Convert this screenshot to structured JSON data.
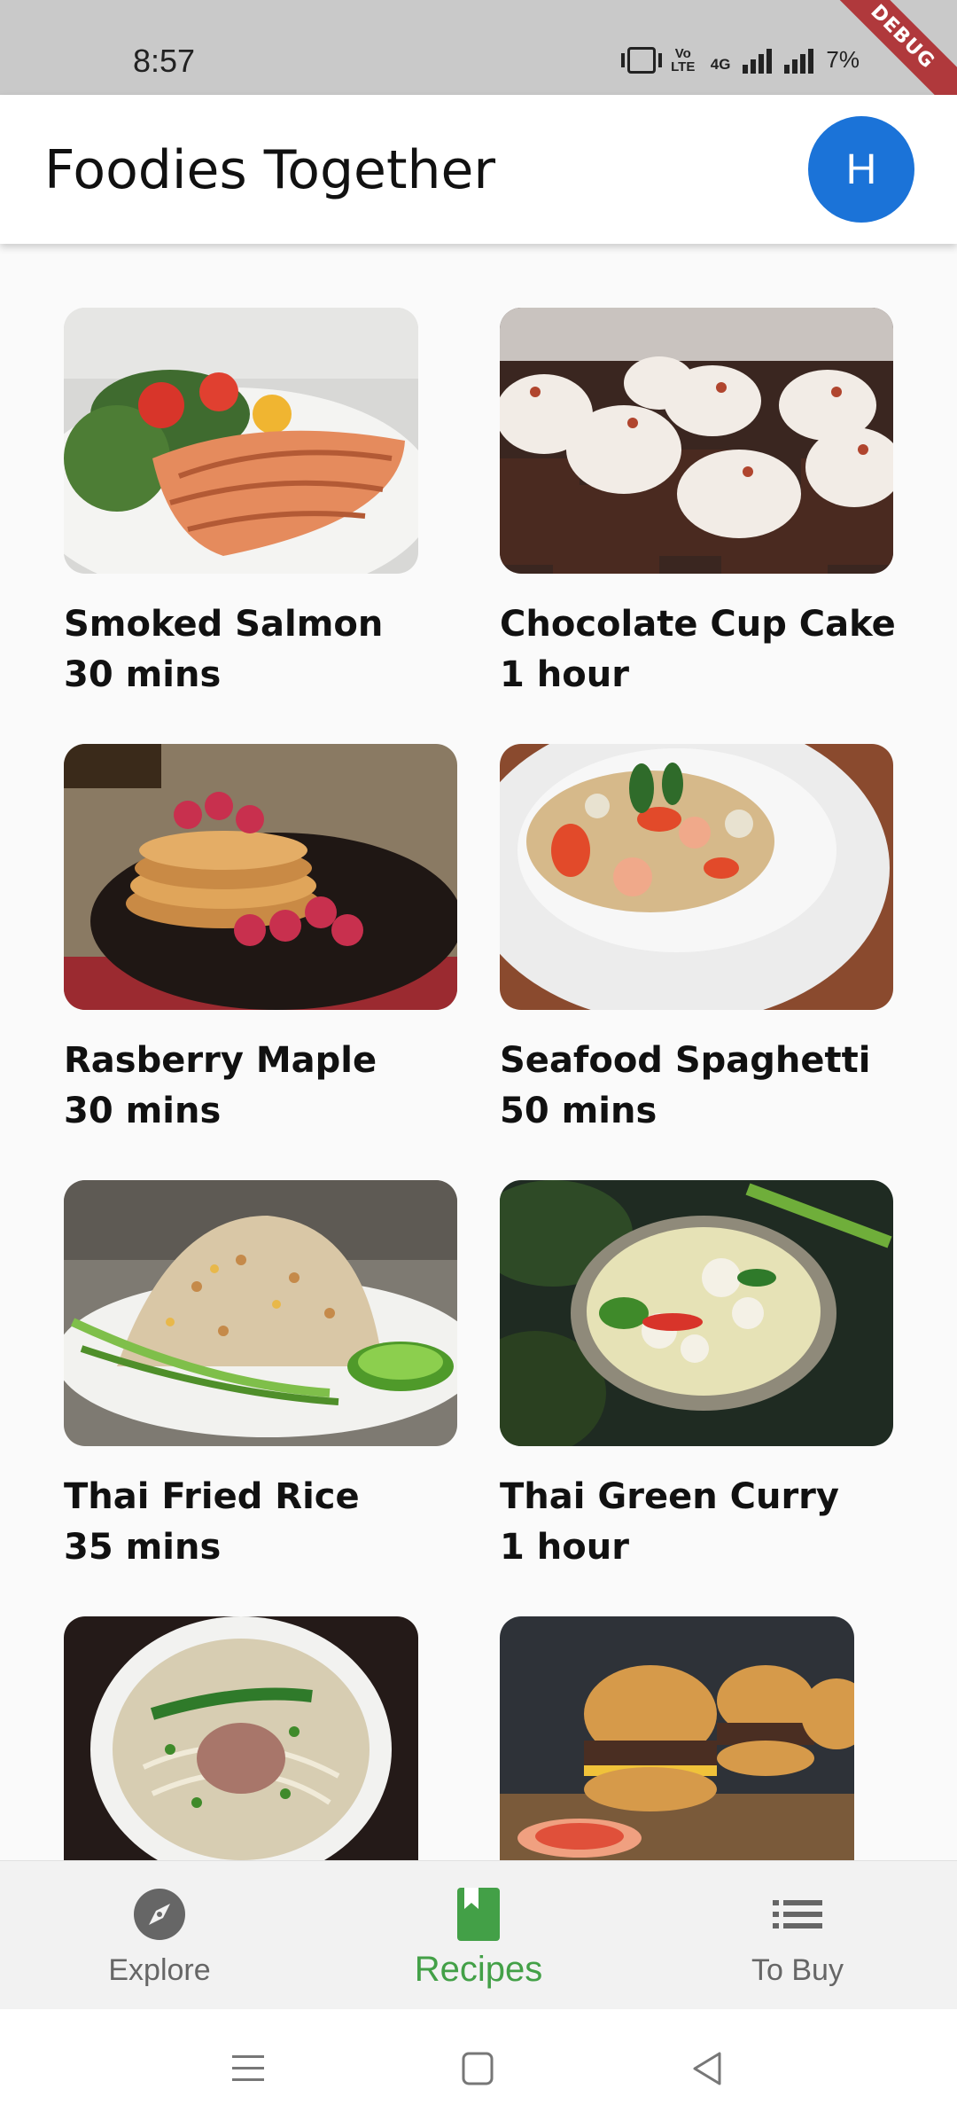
{
  "status_bar": {
    "time": "8:57",
    "volte": "Vo LTE",
    "network": "4G",
    "battery": "7%",
    "debug_banner": "DEBUG"
  },
  "app_bar": {
    "title": "Foodies Together",
    "avatar_initial": "H",
    "avatar_color": "#1b73d8"
  },
  "recipes": [
    {
      "name": "Smoked Salmon",
      "time": "30 mins"
    },
    {
      "name": "Chocolate Cup Cake",
      "time": "1 hour"
    },
    {
      "name": "Rasberry Maple",
      "time": "30 mins"
    },
    {
      "name": "Seafood Spaghetti",
      "time": "50 mins"
    },
    {
      "name": "Thai Fried Rice",
      "time": "35 mins"
    },
    {
      "name": "Thai Green Curry",
      "time": "1 hour"
    }
  ],
  "bottom_nav": {
    "items": [
      {
        "label": "Explore",
        "icon": "compass-icon",
        "active": false
      },
      {
        "label": "Recipes",
        "icon": "book-icon",
        "active": true
      },
      {
        "label": "To Buy",
        "icon": "list-icon",
        "active": false
      }
    ],
    "active_color": "#43a047"
  },
  "system_nav": {
    "icons": [
      "menu-icon",
      "home-icon",
      "back-icon"
    ]
  }
}
